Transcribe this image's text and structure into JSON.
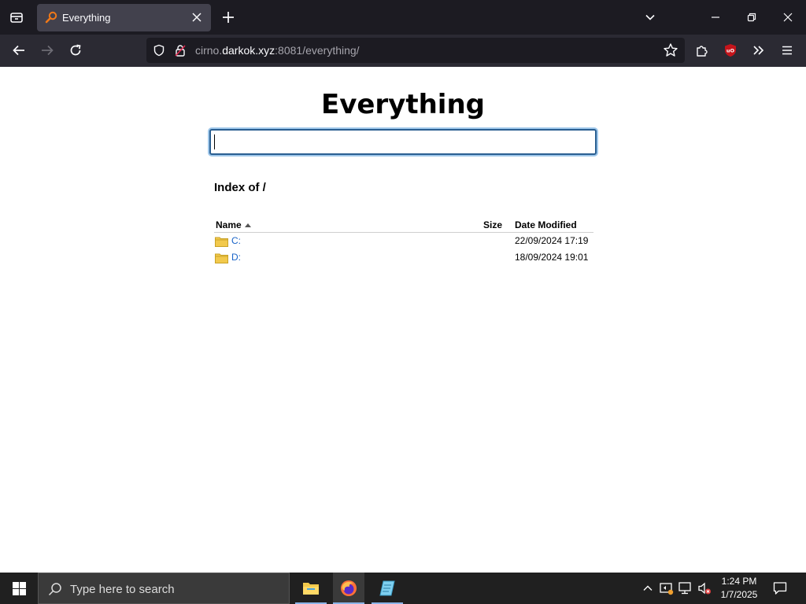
{
  "browser": {
    "tab": {
      "title": "Everything"
    },
    "url": {
      "host_prefix": "cirno.",
      "host_main": "darkok.xyz",
      "rest": ":8081/everything/"
    }
  },
  "page": {
    "title": "Everything",
    "search": {
      "value": "",
      "placeholder": ""
    },
    "index_heading": "Index of /",
    "columns": {
      "name": "Name",
      "size": "Size",
      "date": "Date Modified"
    },
    "rows": [
      {
        "name": "C:",
        "size": "",
        "date": "22/09/2024 17:19"
      },
      {
        "name": "D:",
        "size": "",
        "date": "18/09/2024 19:01"
      }
    ]
  },
  "taskbar": {
    "search_text": "Type here to search",
    "time": "1:24 PM",
    "date": "1/7/2025"
  },
  "colors": {
    "tabbar_bg": "#1c1b22",
    "toolbar_bg": "#2b2a33",
    "link": "#1a64c8",
    "folder": "#f2c94c",
    "ublock_red": "#c4141b"
  }
}
